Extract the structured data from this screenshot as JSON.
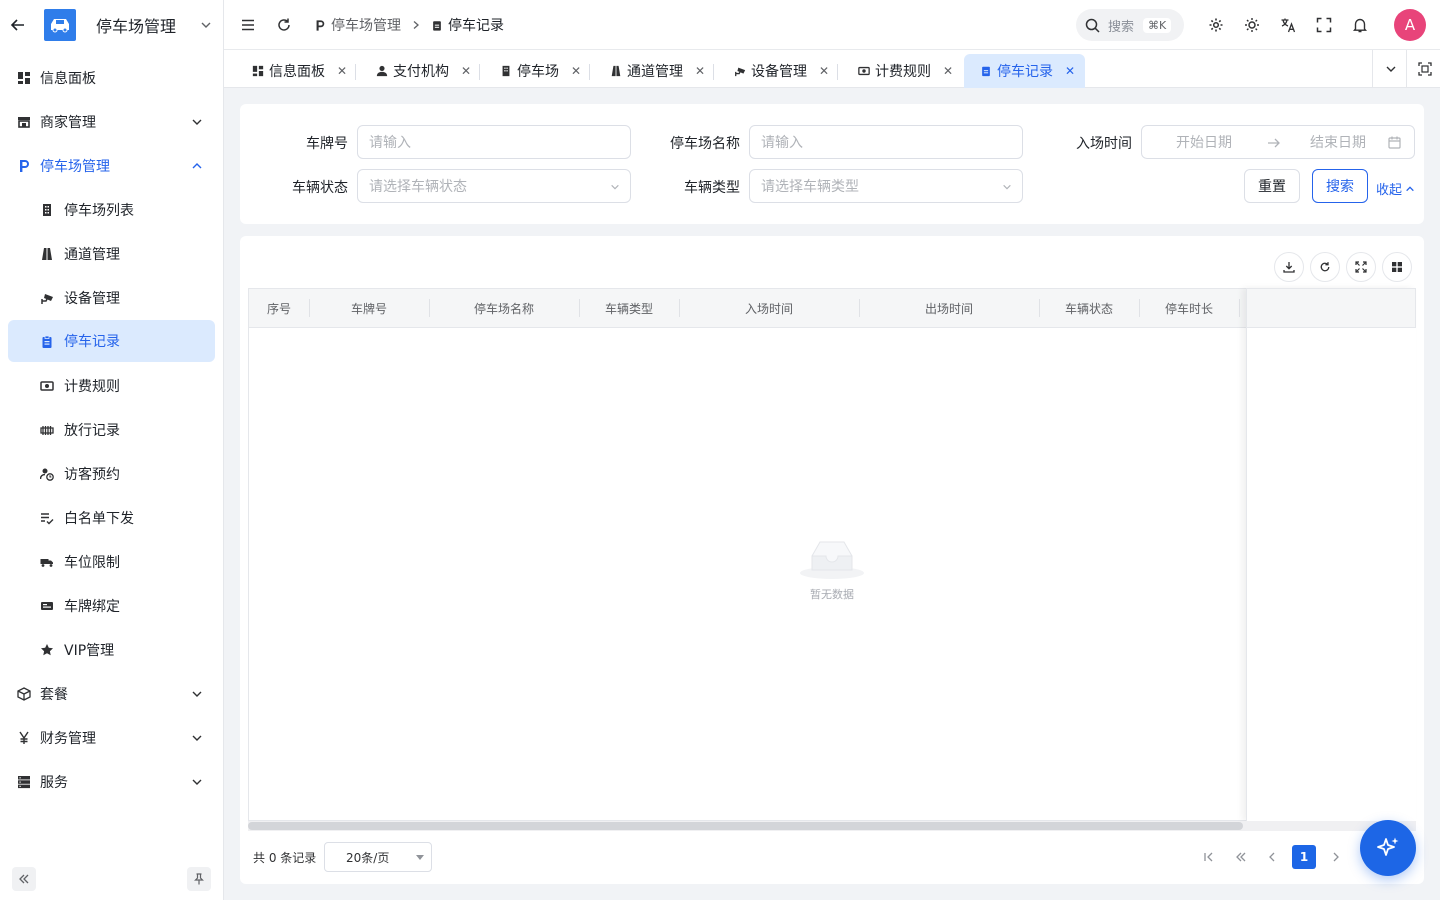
{
  "app": {
    "title": "停车场管理"
  },
  "sidebar": {
    "items": [
      {
        "label": "信息面板",
        "icon": "dashboard-icon"
      },
      {
        "label": "商家管理",
        "icon": "store-icon",
        "expandable": true
      },
      {
        "label": "停车场管理",
        "icon": "parking-icon",
        "expandable": true,
        "open": true
      },
      {
        "label": "停车场列表",
        "icon": "building-icon",
        "sub": true
      },
      {
        "label": "通道管理",
        "icon": "road-icon",
        "sub": true
      },
      {
        "label": "设备管理",
        "icon": "cctv-icon",
        "sub": true
      },
      {
        "label": "停车记录",
        "icon": "clipboard-icon",
        "sub": true,
        "active": true
      },
      {
        "label": "计费规则",
        "icon": "cash-icon",
        "sub": true
      },
      {
        "label": "放行记录",
        "icon": "gate-icon",
        "sub": true
      },
      {
        "label": "访客预约",
        "icon": "visitor-clock-icon",
        "sub": true
      },
      {
        "label": "白名单下发",
        "icon": "list-check-icon",
        "sub": true
      },
      {
        "label": "车位限制",
        "icon": "truck-icon",
        "sub": true
      },
      {
        "label": "车牌绑定",
        "icon": "card-icon",
        "sub": true
      },
      {
        "label": "VIP管理",
        "icon": "star-icon",
        "sub": true
      },
      {
        "label": "套餐",
        "icon": "package-icon",
        "expandable": true
      },
      {
        "label": "财务管理",
        "icon": "yen-icon",
        "expandable": true
      },
      {
        "label": "服务",
        "icon": "server-icon",
        "expandable": true
      }
    ]
  },
  "header": {
    "breadcrumb": [
      {
        "label": "停车场管理"
      },
      {
        "label": "停车记录"
      }
    ],
    "search_label": "搜索",
    "search_shortcut": "⌘K",
    "avatar_letter": "A"
  },
  "tabs": [
    {
      "label": "信息面板"
    },
    {
      "label": "支付机构"
    },
    {
      "label": "停车场"
    },
    {
      "label": "通道管理"
    },
    {
      "label": "设备管理"
    },
    {
      "label": "计费规则"
    },
    {
      "label": "停车记录",
      "active": true
    }
  ],
  "filter": {
    "plate_label": "车牌号",
    "plate_placeholder": "请输入",
    "lot_label": "停车场名称",
    "lot_placeholder": "请输入",
    "entry_label": "入场时间",
    "start_placeholder": "开始日期",
    "end_placeholder": "结束日期",
    "status_label": "车辆状态",
    "status_placeholder": "请选择车辆状态",
    "type_label": "车辆类型",
    "type_placeholder": "请选择车辆类型",
    "reset": "重置",
    "search": "搜索",
    "collapse": "收起"
  },
  "table": {
    "columns": [
      "序号",
      "车牌号",
      "停车场名称",
      "车辆类型",
      "入场时间",
      "出场时间",
      "车辆状态",
      "停车时长"
    ],
    "rows": [],
    "empty_text": "暂无数据",
    "total_text": "共 0 条记录",
    "page_size": "20条/页",
    "current_page": "1"
  },
  "colors": {
    "primary": "#2563eb",
    "active_bg": "#dbeafe",
    "avatar": "#e8447a",
    "fab": "#1d66e6"
  }
}
